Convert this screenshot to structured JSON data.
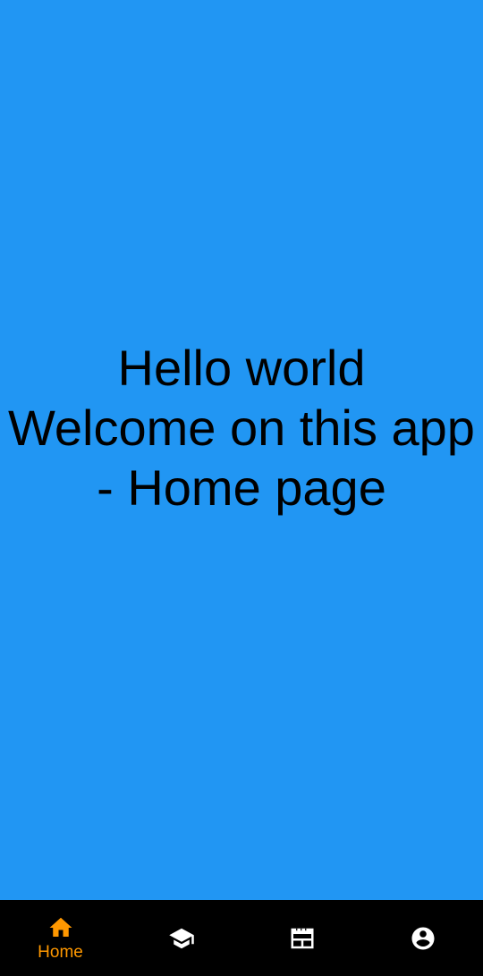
{
  "main": {
    "message": "Hello world\nWelcome on this app\n- Home page",
    "background_color": "#2196F3"
  },
  "bottom_nav": {
    "background_color": "#000000",
    "active_color": "#FF9800",
    "inactive_color": "#FFFFFF",
    "items": [
      {
        "icon": "home-icon",
        "label": "Home",
        "active": true
      },
      {
        "icon": "school-icon",
        "label": "",
        "active": false
      },
      {
        "icon": "calendar-icon",
        "label": "",
        "active": false
      },
      {
        "icon": "account-icon",
        "label": "",
        "active": false
      }
    ]
  }
}
